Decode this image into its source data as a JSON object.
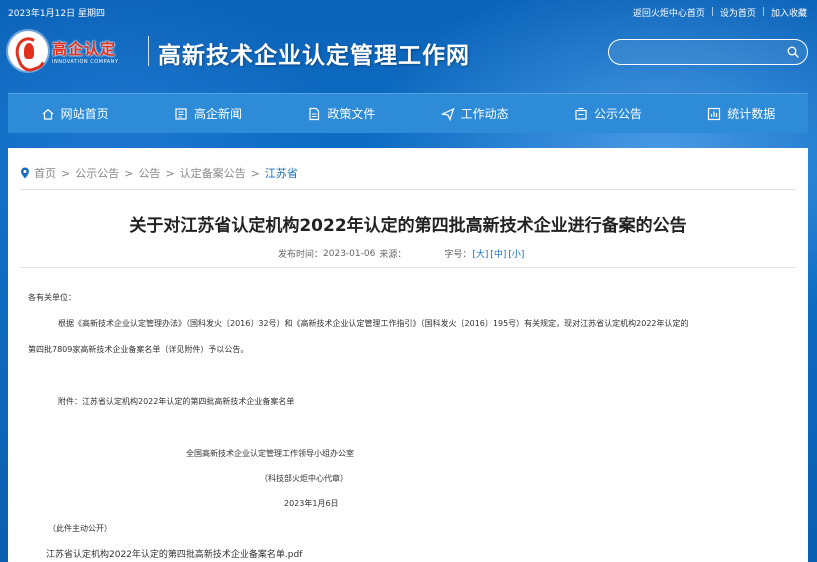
{
  "topbar": {
    "date": "2023年1月12日 星期四",
    "links": [
      "返回火炬中心首页",
      "设为首页",
      "加入收藏"
    ],
    "separator": "|"
  },
  "header": {
    "logo_cn": "高企认定",
    "logo_en": "INNOVATION COMPANY",
    "site_title": "高新技术企业认定管理工作网",
    "search_placeholder": ""
  },
  "nav": {
    "items": [
      {
        "label": "网站首页",
        "icon": "home-icon"
      },
      {
        "label": "高企新闻",
        "icon": "news-icon"
      },
      {
        "label": "政策文件",
        "icon": "document-icon"
      },
      {
        "label": "工作动态",
        "icon": "send-icon"
      },
      {
        "label": "公示公告",
        "icon": "notice-icon"
      },
      {
        "label": "统计数据",
        "icon": "chart-icon"
      }
    ]
  },
  "breadcrumb": {
    "items": [
      "首页",
      "公示公告",
      "公告",
      "认定备案公告"
    ],
    "current": "江苏省",
    "arrow": ">"
  },
  "article": {
    "title": "关于对江苏省认定机构2022年认定的第四批高新技术企业进行备案的公告",
    "publish_label": "发布时间：",
    "publish_date": "2023-01-06",
    "source_label": "来源：",
    "font_size_label": "字号：",
    "font_sizes": [
      "[大]",
      "[中]",
      "[小]"
    ],
    "salutation": "各有关单位：",
    "paragraph_line1": "根据《高新技术企业认定管理办法》（国科发火〔2016〕32号）和《高新技术企业认定管理工作指引》（国科发火〔2016〕195号）有关规定，现对江苏省认定机构2022年认定的",
    "paragraph_line2": "第四批7809家高新技术企业备案名单（详见附件）予以公告。",
    "attachment_note": "附件：江苏省认定机构2022年认定的第四批高新技术企业备案名单",
    "signature_org": "全国高新技术企业认定管理工作领导小组办公室",
    "signature_sub": "（科技部火炬中心代章）",
    "signature_date": "2023年1月6日",
    "disclosure": "（此件主动公开）",
    "attachment_file": "江苏省认定机构2022年认定的第四批高新技术企业备案名单.pdf"
  },
  "colors": {
    "header_bg": "#0b63b8",
    "nav_bg": "#2d8bd8",
    "link_blue": "#1a6fc0",
    "logo_red": "#e0301e"
  }
}
